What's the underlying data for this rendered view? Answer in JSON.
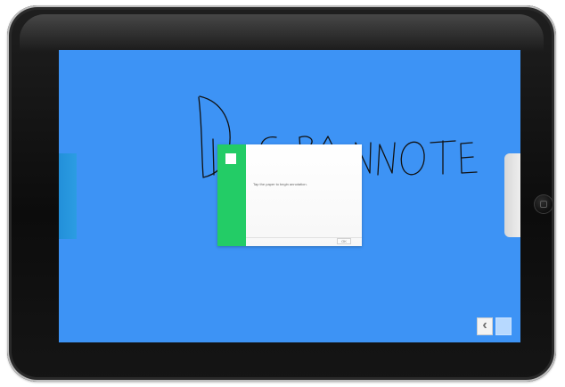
{
  "screen": {
    "background_color": "#3d93f5",
    "handwritten_title": "DIGRANNOTE"
  },
  "dialog": {
    "accent_color": "#23cc66",
    "message": "Tap the paper to begin annotation.",
    "button_label": "OK"
  },
  "navigation": {
    "back_icon": "chevron-left-icon",
    "back_glyph": "‹",
    "next_icon": "blank-button-icon"
  },
  "device": {
    "frame_color": "#111111",
    "home_button_icon": "square-icon"
  }
}
